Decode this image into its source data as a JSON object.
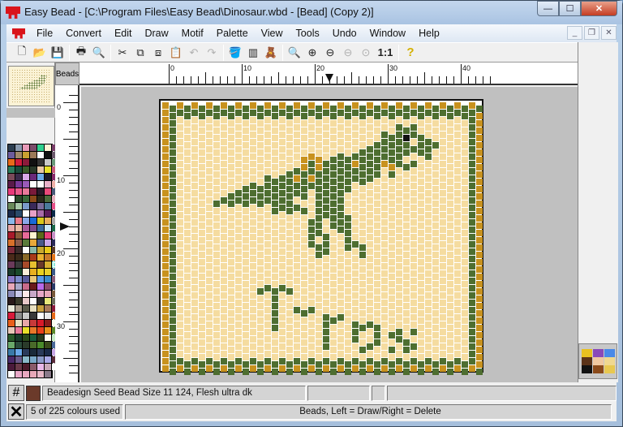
{
  "window": {
    "title": "Easy Bead - [C:\\Program Files\\Easy Bead\\Dinosaur.wbd - [Bead] (Copy 2)]",
    "buttons": {
      "minimize": "—",
      "maximize": "☐",
      "close": "✕"
    }
  },
  "menu": {
    "items": [
      "File",
      "Convert",
      "Edit",
      "Draw",
      "Motif",
      "Palette",
      "View",
      "Tools",
      "Undo",
      "Window",
      "Help"
    ],
    "mdi_buttons": {
      "minimize": "_",
      "restore": "❐",
      "close": "✕"
    }
  },
  "toolbar": {
    "buttons": [
      {
        "name": "new-icon",
        "glyph": "🗋",
        "dim": false
      },
      {
        "name": "open-icon",
        "glyph": "📂",
        "dim": false
      },
      {
        "name": "save-icon",
        "glyph": "💾",
        "dim": false
      },
      {
        "sep": true
      },
      {
        "name": "print-icon",
        "glyph": "🖶",
        "dim": false
      },
      {
        "name": "print-preview-icon",
        "glyph": "🔍",
        "dim": false
      },
      {
        "sep": true
      },
      {
        "name": "cut-icon",
        "glyph": "✂",
        "dim": false
      },
      {
        "name": "copy-icon",
        "glyph": "⧉",
        "dim": false
      },
      {
        "name": "paste-special-icon",
        "glyph": "⧈",
        "dim": false
      },
      {
        "name": "paste-icon",
        "glyph": "📋",
        "dim": true
      },
      {
        "name": "undo-icon",
        "glyph": "↶",
        "dim": true
      },
      {
        "name": "redo-icon",
        "glyph": "↷",
        "dim": true
      },
      {
        "sep": true
      },
      {
        "name": "fill-icon",
        "glyph": "🪣",
        "dim": false
      },
      {
        "name": "colour-bars-icon",
        "glyph": "▥",
        "dim": false
      },
      {
        "name": "motif-icon",
        "glyph": "🧸",
        "dim": false
      },
      {
        "sep": true
      },
      {
        "name": "zoom-icon",
        "glyph": "🔍",
        "dim": false
      },
      {
        "name": "zoom-in-icon",
        "glyph": "⊕",
        "dim": false
      },
      {
        "name": "zoom-out-icon",
        "glyph": "⊖",
        "dim": false
      },
      {
        "name": "zoom-prev-icon",
        "glyph": "⊖",
        "dim": true
      },
      {
        "name": "zoom-fit-icon",
        "glyph": "⊙",
        "dim": true
      },
      {
        "name": "actual-size-button",
        "glyph": "1:1",
        "dim": false,
        "bold": true
      },
      {
        "sep": true
      },
      {
        "name": "help-icon",
        "glyph": "?",
        "dim": false,
        "help": true
      }
    ]
  },
  "ruler": {
    "corner_label": "Beads",
    "h_labels": [
      "0",
      "10",
      "20",
      "30",
      "40"
    ],
    "v_labels": [
      "0",
      "10",
      "20",
      "30"
    ],
    "h_marker_col": 22,
    "v_marker_row": 17
  },
  "pattern": {
    "cols": 44,
    "rows": 37,
    "colors": {
      "bg": "#f5dca0",
      "gold": "#c8921e",
      "green": "#4e6e30",
      "black": "#111111"
    }
  },
  "palette": {
    "colors": [
      "#2c3e50",
      "#8a9bb0",
      "#e89ab8",
      "#7a4c6a",
      "#2fcf8e",
      "#fff4d6",
      "#7a3d6a",
      "#6c5c9c",
      "#a08a6a",
      "#c8a030",
      "#9b7a58",
      "#fdfdfd",
      "#111111",
      "#6c5a6c",
      "#e86a1a",
      "#d01c3a",
      "#8c1a3a",
      "#111111",
      "#333333",
      "#c8c8c8",
      "#6a9a7a",
      "#2c7a5a",
      "#1a4a3a",
      "#3a5a2a",
      "#2a3a2a",
      "#e8c8a8",
      "#e8e02a",
      "#c8587a",
      "#7a4a5a",
      "#3a2a4a",
      "#d8a8e8",
      "#6a2a7a",
      "#6aaae8",
      "#1a1a2a",
      "#8a2a6a",
      "#5a1a4a",
      "#7a3a9a",
      "#9a5ab8",
      "#fdfdfd",
      "#fdfdfd",
      "#e8b0c8",
      "#f0b0a8",
      "#e83a7a",
      "#e85a8a",
      "#e87a9a",
      "#7a1a3a",
      "#2a1a2a",
      "#e84a7a",
      "#4a5a7a",
      "#fdfdfd",
      "#2a4a2a",
      "#3a6a3a",
      "#8a4a1a",
      "#2a2a1a",
      "#4a6a3a",
      "#e8b0c0",
      "#6a8a5a",
      "#a8c8a8",
      "#7a9aca",
      "#3a2a5a",
      "#7a6a9a",
      "#4a7a9a",
      "#e8508a",
      "#1a2a4a",
      "#2a4a6a",
      "#fdfdfd",
      "#e8a0c8",
      "#a86aa8",
      "#5a1a5a",
      "#0a2a4a",
      "#8ab8e8",
      "#e87a8a",
      "#8aa8e8",
      "#1a6ad8",
      "#d8c81a",
      "#e8b05a",
      "#a8a8a8",
      "#e8a8a8",
      "#e8b8a0",
      "#a85a9a",
      "#7a4a8a",
      "#3a6a9a",
      "#c8e8f8",
      "#1a6a4a",
      "#a81a2a",
      "#8a5a3a",
      "#e86a9a",
      "#fdf4d0",
      "#5a6a1a",
      "#e8407a",
      "#c890c8",
      "#d8702a",
      "#8a5a4a",
      "#5a7a3a",
      "#e8a83a",
      "#4a5a8a",
      "#c8a8e8",
      "#2a2a5a",
      "#7a2a3a",
      "#3a2a2a",
      "#fdfdfd",
      "#8ab8a8",
      "#c8a830",
      "#e8c81a",
      "#5a3a2a",
      "#4a2a1a",
      "#3a2a1a",
      "#8a6a2a",
      "#a83a1a",
      "#e8b030",
      "#c87a2a",
      "#e8781a",
      "#6a3a5a",
      "#3a3a3a",
      "#a84a2a",
      "#e8c030",
      "#6b3a2a",
      "#d8b030",
      "#8ae8d8",
      "#1a3a2a",
      "#1a4a2a",
      "#fdeed8",
      "#e8b020",
      "#e8d020",
      "#e8d02a",
      "#3a5a8a",
      "#8a7ac8",
      "#7a8ac8",
      "#5a5a9a",
      "#e8c87a",
      "#5a9ae8",
      "#3a8ac8",
      "#8a5a7a",
      "#e8a8b8",
      "#a8a8c8",
      "#c86a8a",
      "#6a1a1a",
      "#b86ae8",
      "#8a4a6a",
      "#2a3a6a",
      "#8a8ab8",
      "#c8c8e8",
      "#fde8e8",
      "#c8a8c8",
      "#e8a8c8",
      "#e8a8b8",
      "#7a5a3a",
      "#2a1a1a",
      "#3a3a2a",
      "#e8c8c8",
      "#fdfdfd",
      "#2a2a2a",
      "#e8e87a",
      "#6a6a5a",
      "#e8e8d8",
      "#a89a8a",
      "#5a5a4a",
      "#e8e0c0",
      "#c8a040",
      "#a87a5a",
      "#8a1a3a",
      "#d81a3a",
      "#8a8a8a",
      "#c8c8c8",
      "#3a3a3a",
      "#fdfdfd",
      "#e8e8e8",
      "#e86a1a",
      "#e8601a",
      "#e8e0c0",
      "#e8a8a8",
      "#c83a3a",
      "#d81a2a",
      "#8a1a1a",
      "#fdfdf0",
      "#e8c8b8",
      "#e87a9a",
      "#e8e02a",
      "#e8782a",
      "#e8401a",
      "#e8901a",
      "#5a8a2a",
      "#2a5a2a",
      "#1a3a2a",
      "#2a4a1a",
      "#1a5a3a",
      "#2a3a1a",
      "#fdfdf0",
      "#c8f0c8",
      "#6aa86a",
      "#2a4a3a",
      "#2a3a2a",
      "#4a6a2a",
      "#4a8a2a",
      "#3a4a1a",
      "#4a6a9a",
      "#3a7aa8",
      "#6aa8e8",
      "#2a3a5a",
      "#1a2a3a",
      "#2a3a5a",
      "#1a2a4a",
      "#c8a8e8",
      "#4a2a6a",
      "#6a5a8a",
      "#8ab8c8",
      "#7aa8c8",
      "#8a9ac8",
      "#a8a8e8",
      "#5a2a3a",
      "#4a1a3a",
      "#6a3a4a",
      "#4a1a2a",
      "#8a5a6a",
      "#e8b8e8",
      "#c8a8b8",
      "#fdfdfd",
      "#fdfdfd",
      "#e8a8c8",
      "#e8a8c0",
      "#e8a8b8",
      "#e8b8c8",
      "#8a7a8a"
    ],
    "selected_index": 118
  },
  "status": {
    "current_colour_swatch": "#6b3a2a",
    "current_colour_name": "Beadesign Seed Bead Size 11 124, Flesh ultra dk",
    "colours_used": "5 of 225 colours used",
    "mode_hint": "Beads,  Left = Draw/Right = Delete"
  }
}
